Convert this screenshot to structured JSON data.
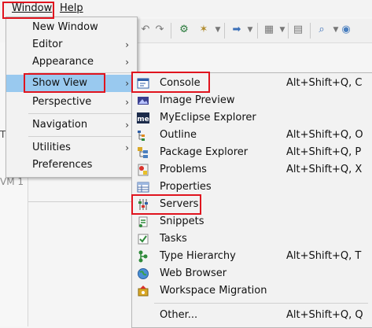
{
  "menubar": {
    "window": "Window",
    "help": "Help"
  },
  "window_menu": {
    "items": [
      {
        "label": "New Window",
        "submenu": false
      },
      {
        "label": "Editor",
        "submenu": true
      },
      {
        "label": "Appearance",
        "submenu": true
      },
      {
        "label": "Show View",
        "submenu": true,
        "selected": true
      },
      {
        "label": "Perspective",
        "submenu": true
      },
      {
        "label": "Navigation",
        "submenu": true
      },
      {
        "label": "Utilities",
        "submenu": true
      },
      {
        "label": "Preferences",
        "submenu": false
      }
    ]
  },
  "show_view": {
    "items": [
      {
        "label": "Console",
        "accel": "Alt+Shift+Q, C",
        "icon": "console-icon"
      },
      {
        "label": "Image Preview",
        "accel": "",
        "icon": "image-preview-icon"
      },
      {
        "label": "MyEclipse Explorer",
        "accel": "",
        "icon": "myeclipse-explorer-icon",
        "icon_text": "me"
      },
      {
        "label": "Outline",
        "accel": "Alt+Shift+Q, O",
        "icon": "outline-icon"
      },
      {
        "label": "Package Explorer",
        "accel": "Alt+Shift+Q, P",
        "icon": "package-explorer-icon"
      },
      {
        "label": "Problems",
        "accel": "Alt+Shift+Q, X",
        "icon": "problems-icon"
      },
      {
        "label": "Properties",
        "accel": "",
        "icon": "properties-icon"
      },
      {
        "label": "Servers",
        "accel": "",
        "icon": "servers-icon"
      },
      {
        "label": "Snippets",
        "accel": "",
        "icon": "snippets-icon"
      },
      {
        "label": "Tasks",
        "accel": "",
        "icon": "tasks-icon"
      },
      {
        "label": "Type Hierarchy",
        "accel": "Alt+Shift+Q, T",
        "icon": "type-hierarchy-icon"
      },
      {
        "label": "Web Browser",
        "accel": "",
        "icon": "web-browser-icon"
      },
      {
        "label": "Workspace Migration",
        "accel": "",
        "icon": "workspace-migration-icon"
      },
      {
        "label": "Other...",
        "accel": "Alt+Shift+Q, Q",
        "icon": ""
      }
    ]
  },
  "background": {
    "fragment_t": "T",
    "fragment_vm": "VM 1"
  },
  "colors": {
    "highlight": "#99c9ef",
    "annotation": "#e0141e"
  }
}
